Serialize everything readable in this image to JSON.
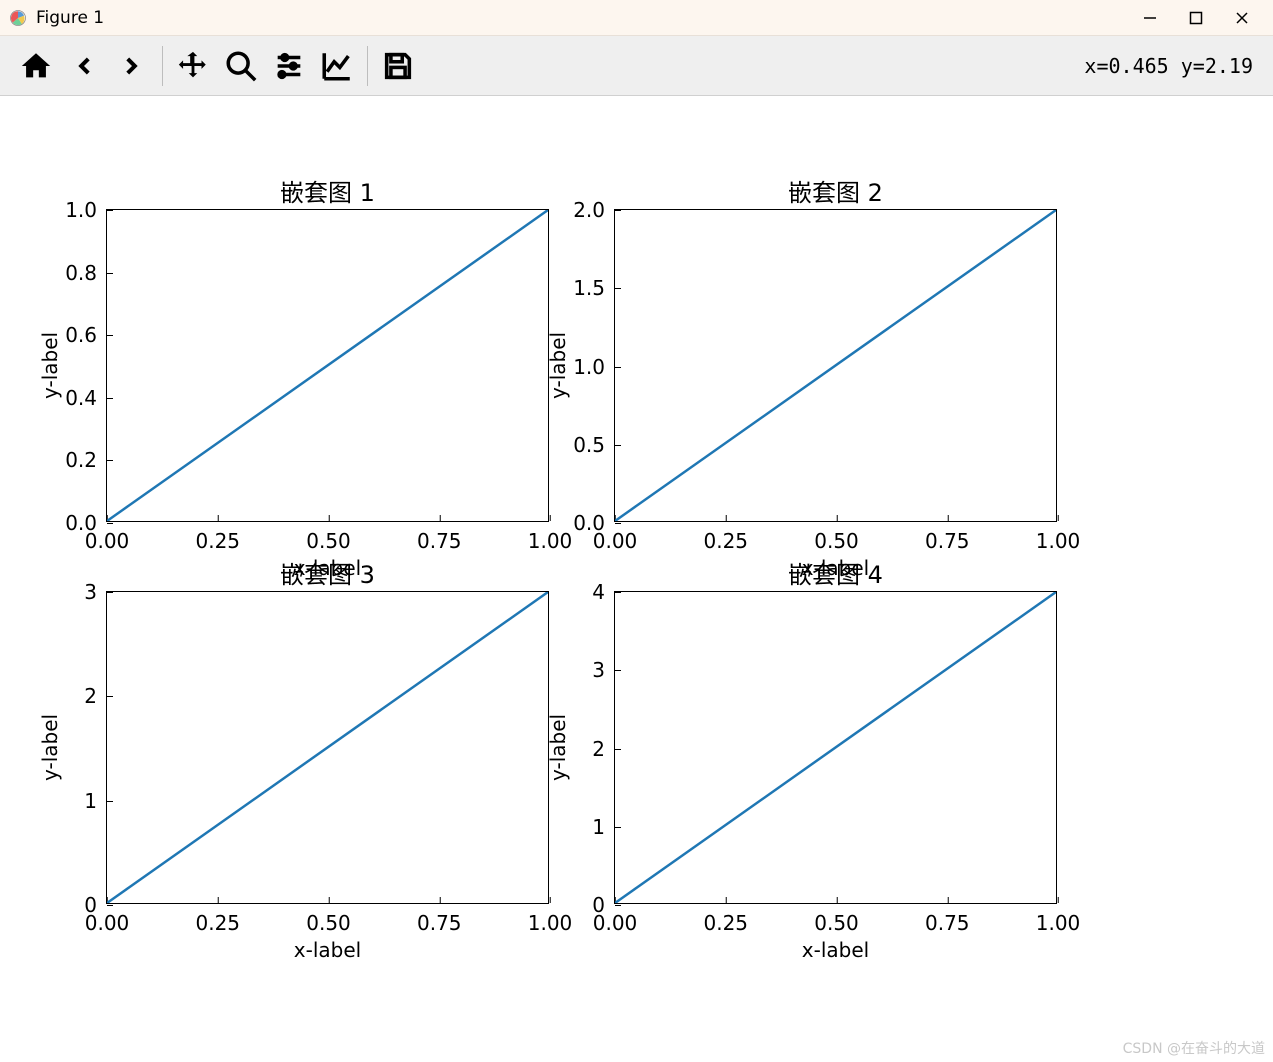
{
  "window": {
    "title": "Figure 1"
  },
  "toolbar": {
    "cursor_text": "x=0.465 y=2.19"
  },
  "watermark": "CSDN @在奋斗的大道",
  "chart_data": [
    {
      "type": "line",
      "title": "嵌套图 1",
      "xlabel": "x-label",
      "ylabel": "y-label",
      "x": [
        0.0,
        1.0
      ],
      "y": [
        0.0,
        1.0
      ],
      "xlim": [
        0.0,
        1.0
      ],
      "ylim": [
        0.0,
        1.0
      ],
      "xticks": [
        "0.00",
        "0.25",
        "0.50",
        "0.75",
        "1.00"
      ],
      "yticks": [
        "0.0",
        "0.2",
        "0.4",
        "0.6",
        "0.8",
        "1.0"
      ]
    },
    {
      "type": "line",
      "title": "嵌套图 2",
      "xlabel": "x-label",
      "ylabel": "y-label",
      "x": [
        0.0,
        1.0
      ],
      "y": [
        0.0,
        2.0
      ],
      "xlim": [
        0.0,
        1.0
      ],
      "ylim": [
        0.0,
        2.0
      ],
      "xticks": [
        "0.00",
        "0.25",
        "0.50",
        "0.75",
        "1.00"
      ],
      "yticks": [
        "0.0",
        "0.5",
        "1.0",
        "1.5",
        "2.0"
      ]
    },
    {
      "type": "line",
      "title": "嵌套图 3",
      "xlabel": "x-label",
      "ylabel": "y-label",
      "x": [
        0.0,
        1.0
      ],
      "y": [
        0.0,
        3.0
      ],
      "xlim": [
        0.0,
        1.0
      ],
      "ylim": [
        0.0,
        3.0
      ],
      "xticks": [
        "0.00",
        "0.25",
        "0.50",
        "0.75",
        "1.00"
      ],
      "yticks": [
        "0",
        "1",
        "2",
        "3"
      ]
    },
    {
      "type": "line",
      "title": "嵌套图 4",
      "xlabel": "x-label",
      "ylabel": "y-label",
      "x": [
        0.0,
        1.0
      ],
      "y": [
        0.0,
        4.0
      ],
      "xlim": [
        0.0,
        1.0
      ],
      "ylim": [
        0.0,
        4.0
      ],
      "xticks": [
        "0.00",
        "0.25",
        "0.50",
        "0.75",
        "1.00"
      ],
      "yticks": [
        "0",
        "1",
        "2",
        "3",
        "4"
      ]
    }
  ],
  "line_color": "#1f77b4"
}
